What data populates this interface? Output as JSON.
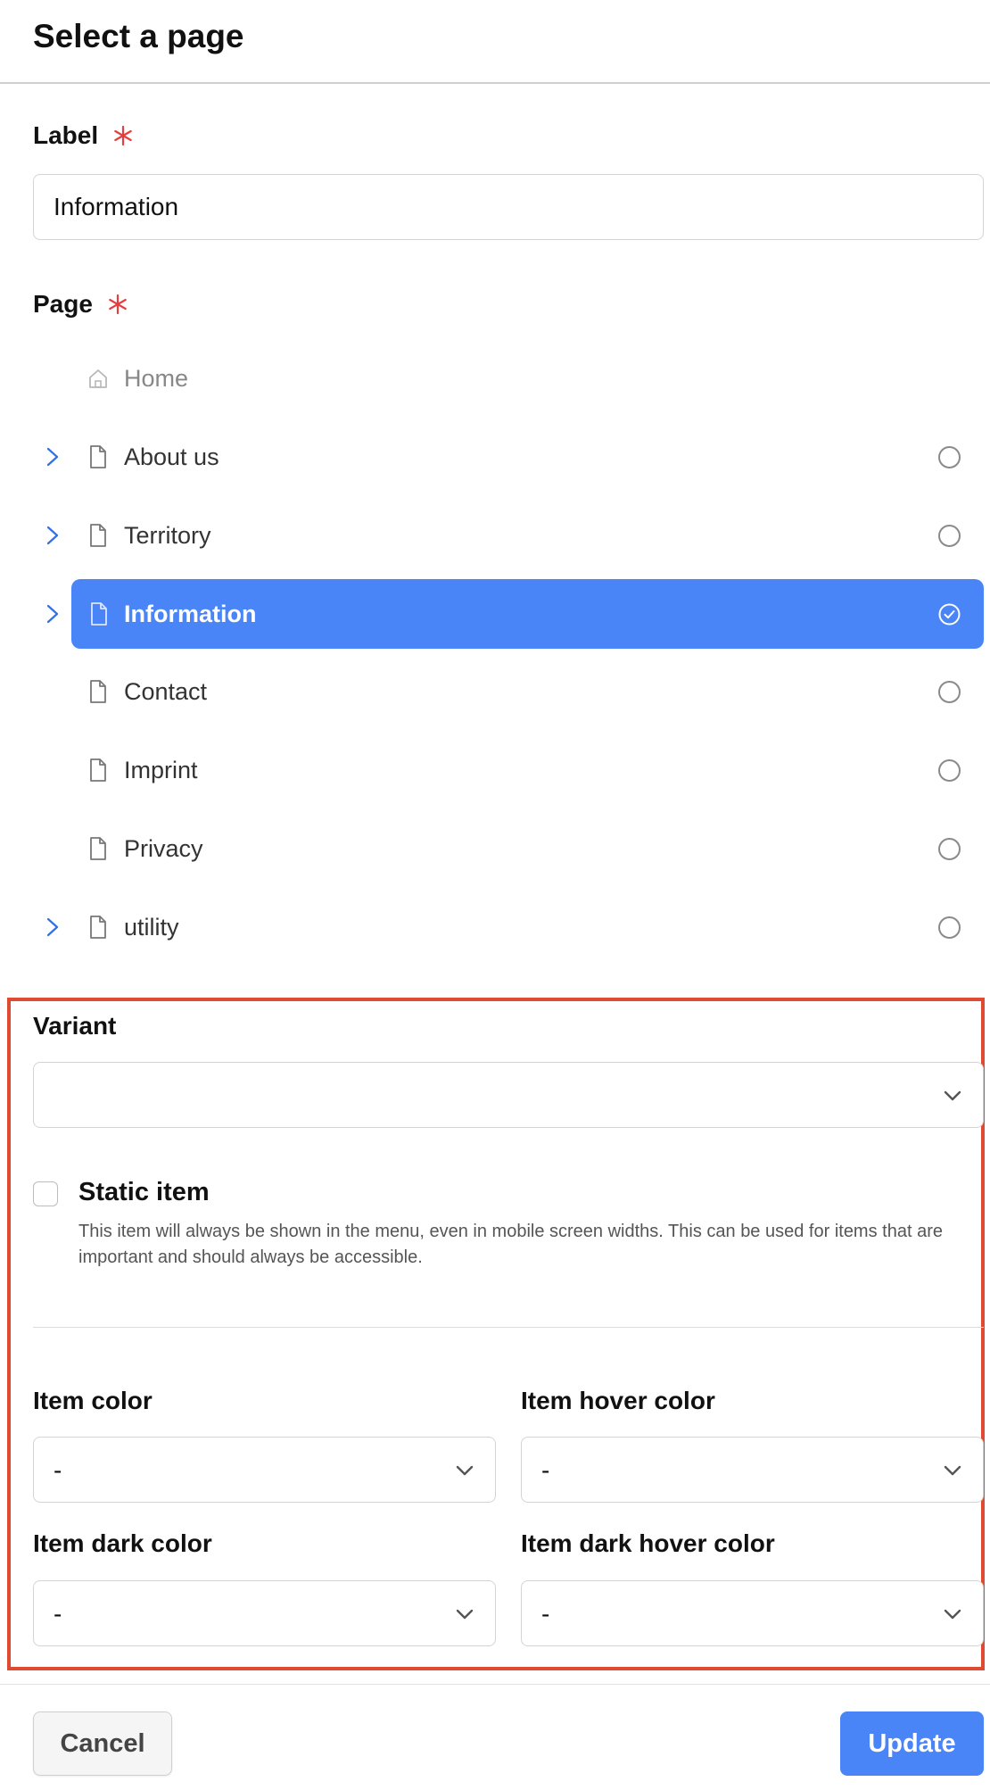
{
  "header": {
    "title": "Select a page"
  },
  "label_field": {
    "label": "Label",
    "value": "Information"
  },
  "page_field": {
    "label": "Page",
    "items": [
      {
        "label": "Home",
        "icon": "home-icon",
        "expandable": false,
        "selected": false
      },
      {
        "label": "About us",
        "icon": "page-icon",
        "expandable": true,
        "selected": false
      },
      {
        "label": "Territory",
        "icon": "page-icon",
        "expandable": true,
        "selected": false
      },
      {
        "label": "Information",
        "icon": "page-icon",
        "expandable": true,
        "selected": true
      },
      {
        "label": "Contact",
        "icon": "page-icon",
        "expandable": false,
        "selected": false
      },
      {
        "label": "Imprint",
        "icon": "page-icon",
        "expandable": false,
        "selected": false
      },
      {
        "label": "Privacy",
        "icon": "page-icon",
        "expandable": false,
        "selected": false
      },
      {
        "label": "utility",
        "icon": "page-icon",
        "expandable": true,
        "selected": false
      }
    ]
  },
  "variant": {
    "label": "Variant",
    "value": ""
  },
  "static_item": {
    "label": "Static item",
    "checked": false,
    "description": "This item will always be shown in the menu, even in mobile screen widths. This can be used for items that are important and should always be accessible."
  },
  "colors": {
    "item_color": {
      "label": "Item color",
      "value": "-"
    },
    "item_hover_color": {
      "label": "Item hover color",
      "value": "-"
    },
    "item_dark_color": {
      "label": "Item dark color",
      "value": "-"
    },
    "item_dark_hover_color": {
      "label": "Item dark hover color",
      "value": "-"
    }
  },
  "footer": {
    "cancel_label": "Cancel",
    "update_label": "Update"
  },
  "theme": {
    "accent": "#4a85f7",
    "required": "#e53e3e",
    "highlight_border": "#de4a32"
  }
}
